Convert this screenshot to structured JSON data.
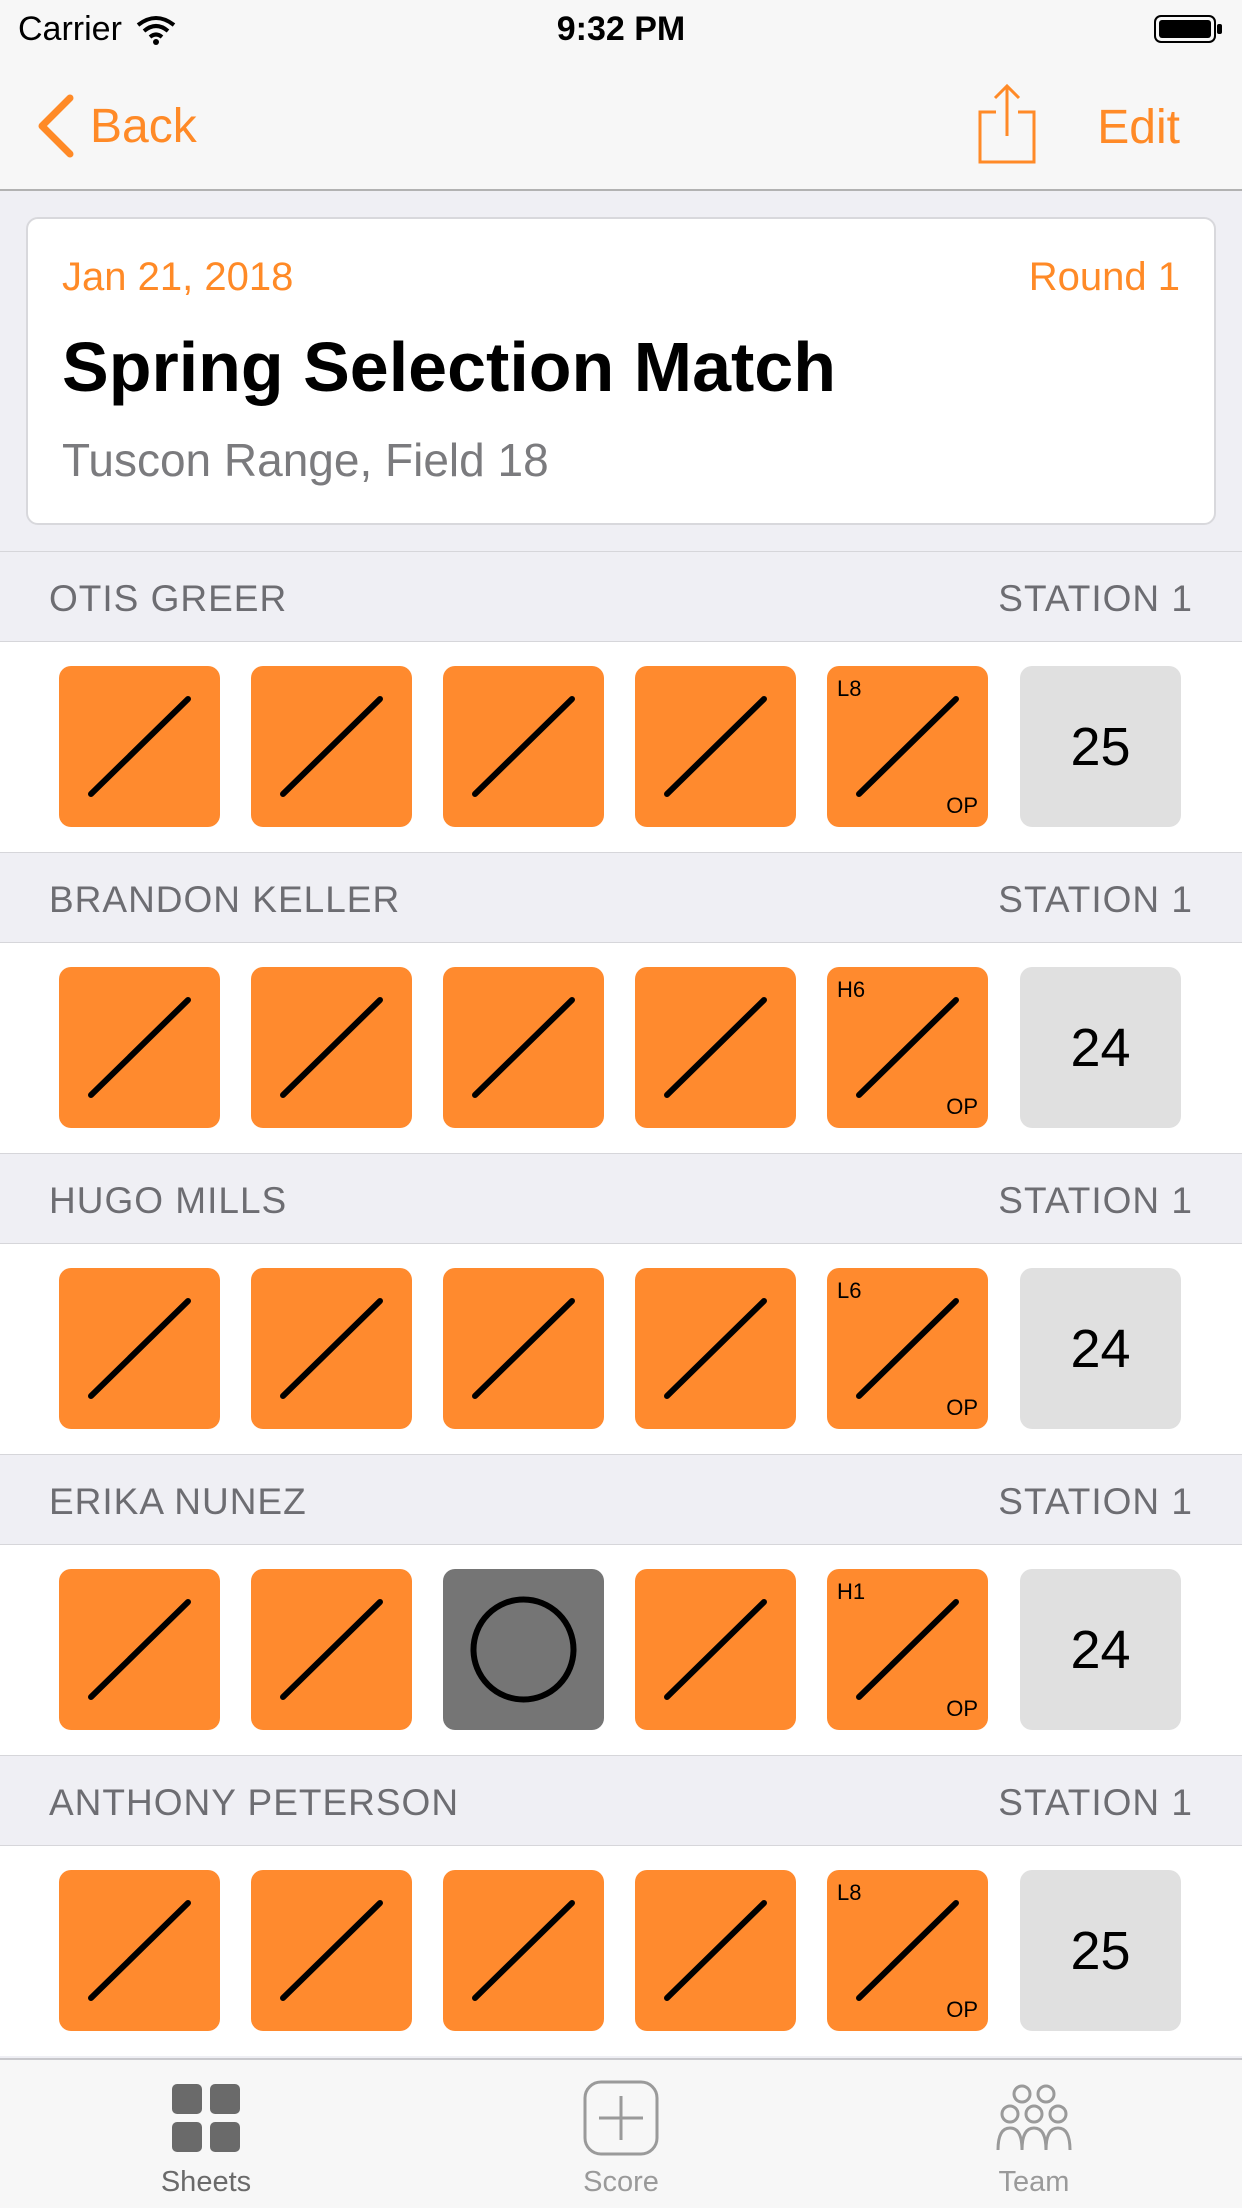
{
  "status_bar": {
    "carrier": "Carrier",
    "time": "9:32 PM"
  },
  "nav": {
    "back_label": "Back",
    "edit_label": "Edit"
  },
  "match": {
    "date": "Jan 21, 2018",
    "round": "Round 1",
    "title": "Spring Selection Match",
    "location": "Tuscon Range, Field 18"
  },
  "shooters": [
    {
      "name": "OTIS GREER",
      "station": "STATION 1",
      "total": "25",
      "targets": [
        "hit",
        "hit",
        "hit",
        "hit",
        "hit"
      ],
      "post_label": "L8",
      "post_suffix": "OP"
    },
    {
      "name": "BRANDON KELLER",
      "station": "STATION 1",
      "total": "24",
      "targets": [
        "hit",
        "hit",
        "hit",
        "hit",
        "hit"
      ],
      "post_label": "H6",
      "post_suffix": "OP"
    },
    {
      "name": "HUGO MILLS",
      "station": "STATION 1",
      "total": "24",
      "targets": [
        "hit",
        "hit",
        "hit",
        "hit",
        "hit"
      ],
      "post_label": "L6",
      "post_suffix": "OP"
    },
    {
      "name": "ERIKA NUNEZ",
      "station": "STATION 1",
      "total": "24",
      "targets": [
        "hit",
        "hit",
        "miss",
        "hit",
        "hit"
      ],
      "post_label": "H1",
      "post_suffix": "OP"
    },
    {
      "name": "ANTHONY PETERSON",
      "station": "STATION 1",
      "total": "25",
      "targets": [
        "hit",
        "hit",
        "hit",
        "hit",
        "hit"
      ],
      "post_label": "L8",
      "post_suffix": "OP"
    }
  ],
  "tabs": [
    {
      "label": "Sheets",
      "icon": "grid-icon",
      "active": true
    },
    {
      "label": "Score",
      "icon": "plus-circle-icon",
      "active": false
    },
    {
      "label": "Team",
      "icon": "team-icon",
      "active": false
    }
  ],
  "colors": {
    "accent": "#ff8a27",
    "hit_tile": "#ff8a2e",
    "miss_tile": "#757575",
    "total_tile": "#e0e0e0"
  }
}
